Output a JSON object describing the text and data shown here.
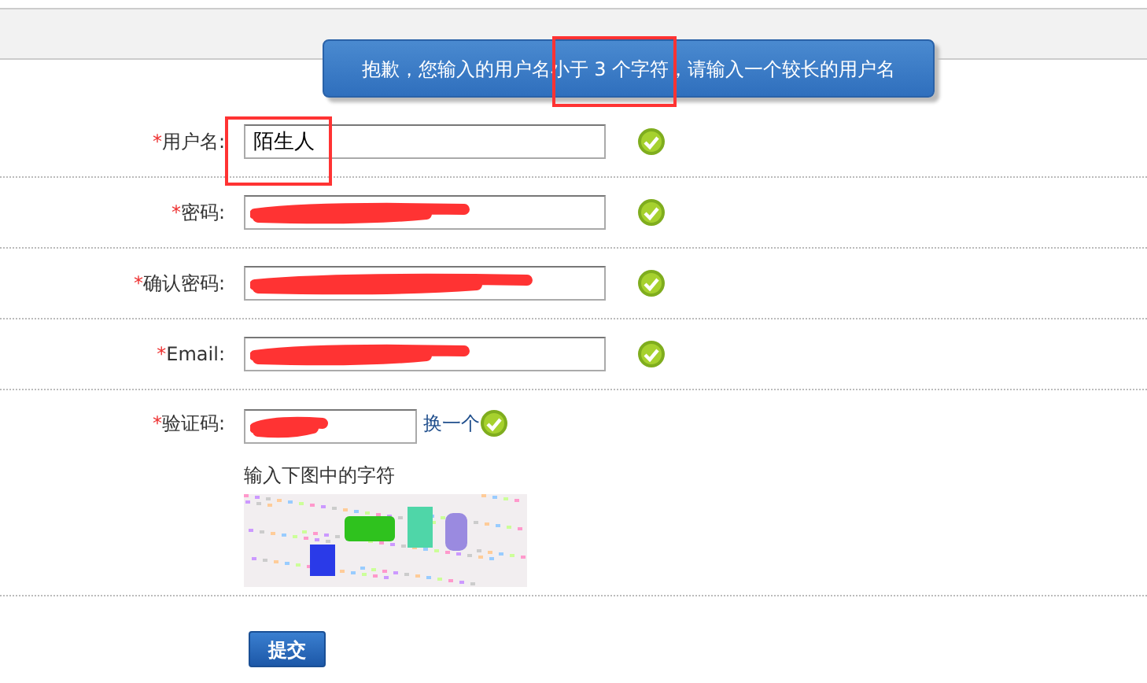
{
  "tooltip": {
    "text": "抱歉，您输入的用户名小于 3 个字符，请输入一个较长的用户名"
  },
  "fields": [
    {
      "kind": "text",
      "required_mark": "*",
      "label": "用户名:",
      "value": "陌生人",
      "valid": true
    },
    {
      "kind": "text",
      "required_mark": "*",
      "label": "密码:",
      "redacted": true,
      "valid": true
    },
    {
      "kind": "text",
      "required_mark": "*",
      "label": "确认密码:",
      "redacted": true,
      "valid": true
    },
    {
      "kind": "text",
      "required_mark": "*",
      "label": "Email:",
      "redacted": true,
      "valid": true
    },
    {
      "kind": "captcha",
      "required_mark": "*",
      "label": "验证码:",
      "redacted": true,
      "valid": true,
      "refresh_link": "换一个",
      "hint": "输入下图中的字符"
    }
  ],
  "submit_button": "提交",
  "annotations": [
    {
      "kind": "box"
    },
    {
      "kind": "box"
    }
  ]
}
